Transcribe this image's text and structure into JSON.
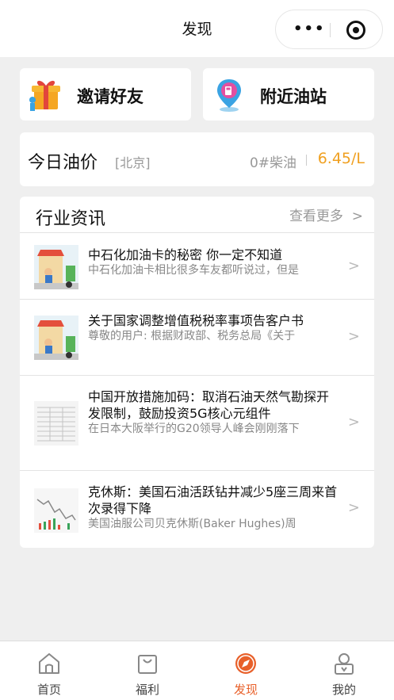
{
  "navbar": {
    "title": "发现"
  },
  "shortcuts": [
    {
      "label": "邀请好友",
      "icon": "gift-icon"
    },
    {
      "label": "附近油站",
      "icon": "gas-station-pin-icon"
    }
  ],
  "oil_price": {
    "title": "今日油价",
    "city": "[北京]",
    "fuel_type": "0#柴油",
    "price": "6.45/L"
  },
  "news": {
    "title": "行业资讯",
    "more_label": "查看更多",
    "items": [
      {
        "headline": "中石化加油卡的秘密 你一定不知道",
        "snippet": "中石化加油卡相比很多车友都听说过，但是",
        "thumb": "gas-station-illustration"
      },
      {
        "headline": "关于国家调整增值税税率事项告客户书",
        "snippet": "尊敬的用户: 根据财政部、税务总局《关于",
        "thumb": "gas-station-illustration"
      },
      {
        "headline": "中国开放措施加码：取消石油天然气勘探开发限制，鼓励投资5G核心元组件",
        "snippet": "在日本大阪举行的G20领导人峰会刚刚落下",
        "thumb": "document-table-image"
      },
      {
        "headline": "克休斯：美国石油活跃钻井减少5座三周来首次录得下降",
        "snippet": "美国油服公司贝克休斯(Baker Hughes)周",
        "thumb": "stock-chart-image"
      }
    ]
  },
  "tabbar": {
    "items": [
      {
        "label": "首页",
        "icon": "home-icon"
      },
      {
        "label": "福利",
        "icon": "shopping-bag-icon"
      },
      {
        "label": "发现",
        "icon": "compass-icon",
        "active": true
      },
      {
        "label": "我的",
        "icon": "user-icon"
      }
    ]
  },
  "colors": {
    "accent": "#e8602a",
    "price": "#f0a020",
    "background": "#efefef"
  }
}
